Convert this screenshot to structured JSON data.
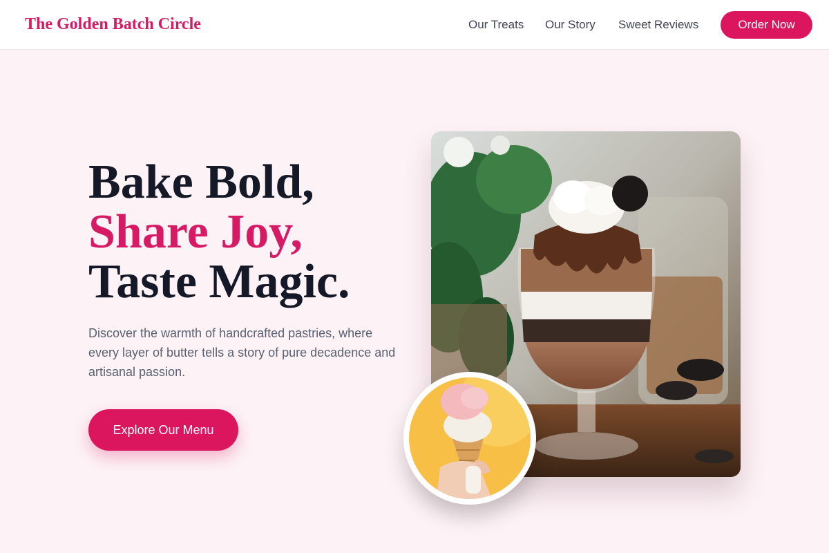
{
  "brand": {
    "name": "The Golden Batch Circle"
  },
  "nav": {
    "links": [
      "Our Treats",
      "Our Story",
      "Sweet Reviews"
    ],
    "order_label": "Order Now"
  },
  "hero": {
    "headline": [
      "Bake Bold,",
      "Share Joy,",
      "Taste Magic."
    ],
    "subtext": "Discover the warmth of handcrafted pastries, where every layer of butter tells a story of pure decadence and artisanal passion.",
    "cta_label": "Explore Our Menu"
  },
  "images": {
    "main_icon": "dessert-parfait-photo",
    "secondary_icon": "ice-cream-cone-photo"
  },
  "colors": {
    "accent": "#dc155f",
    "background": "#fdf2f6",
    "headline": "#141827"
  }
}
